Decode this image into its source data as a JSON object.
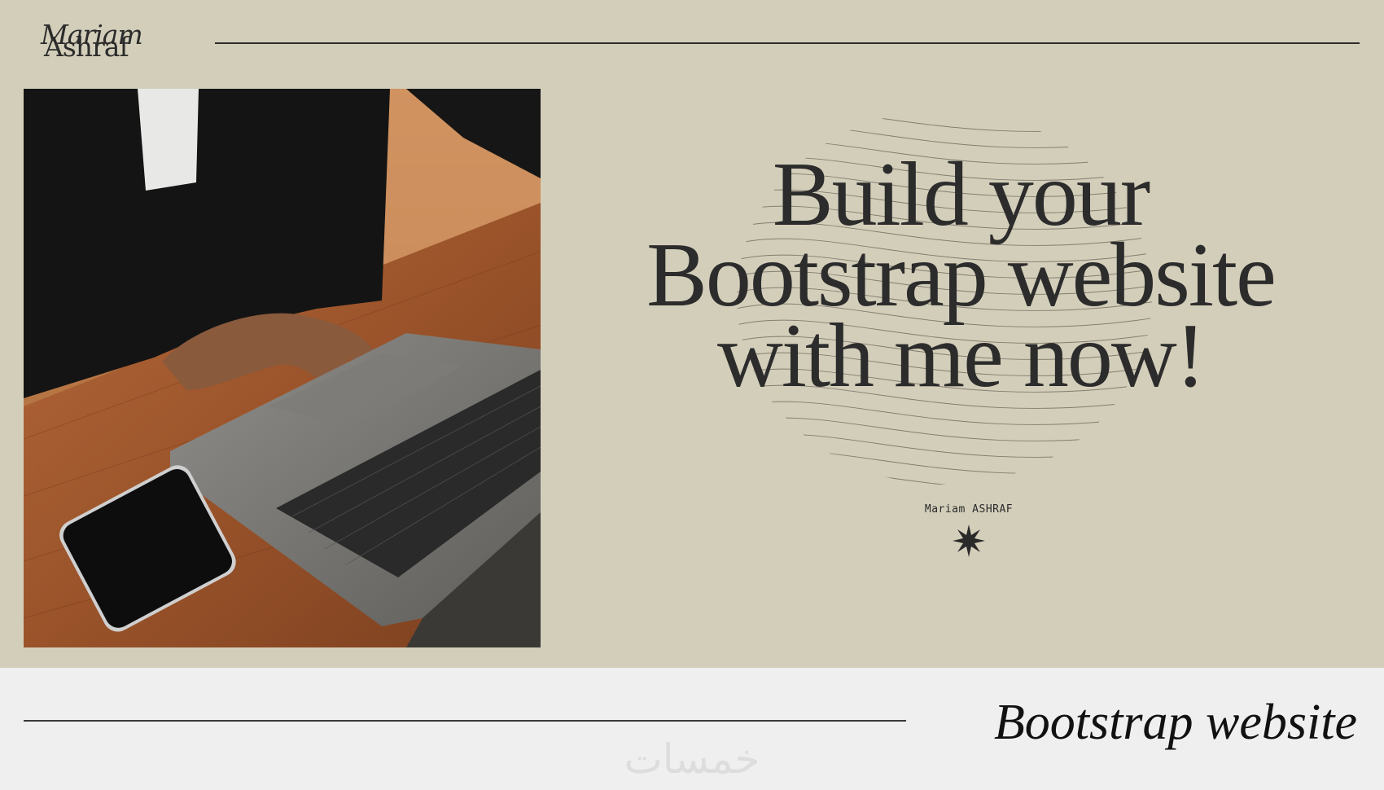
{
  "logo": {
    "first": "Mariam",
    "last": "Ashraf"
  },
  "hero": {
    "headline_lines": [
      "Build your",
      "Bootstrap website",
      "with me now!"
    ],
    "author": "Mariam ASHRAF"
  },
  "footer": {
    "title": "Bootstrap website",
    "watermark": "خمسات"
  },
  "colors": {
    "banner_bg": "#d3ceba",
    "page_bg": "#efefef",
    "text_dark": "#2c2c2c"
  },
  "icons": {
    "sparkle": "eight-point-star-icon"
  }
}
